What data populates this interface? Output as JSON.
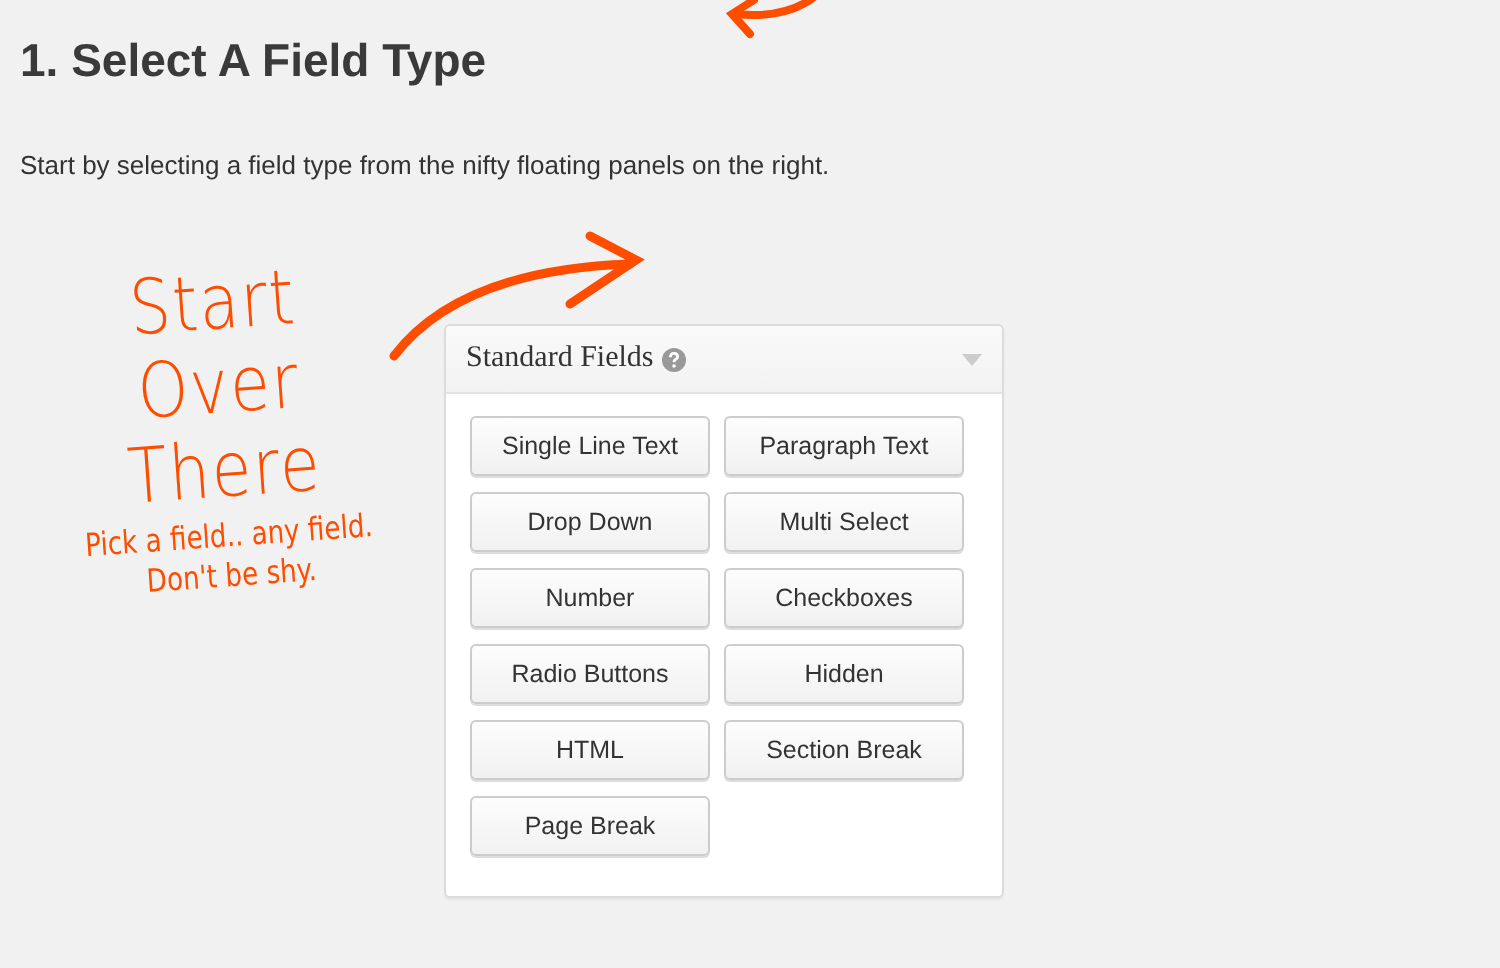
{
  "heading": "1. Select A Field Type",
  "intro": "Start by selecting a field type from the nifty floating panels on the right.",
  "annotation": {
    "title": "Start Over There",
    "note": "Pick a field.. any field. Don't be shy."
  },
  "panel": {
    "title": "Standard Fields",
    "buttons": [
      "Single Line Text",
      "Paragraph Text",
      "Drop Down",
      "Multi Select",
      "Number",
      "Checkboxes",
      "Radio Buttons",
      "Hidden",
      "HTML",
      "Section Break",
      "Page Break"
    ]
  }
}
